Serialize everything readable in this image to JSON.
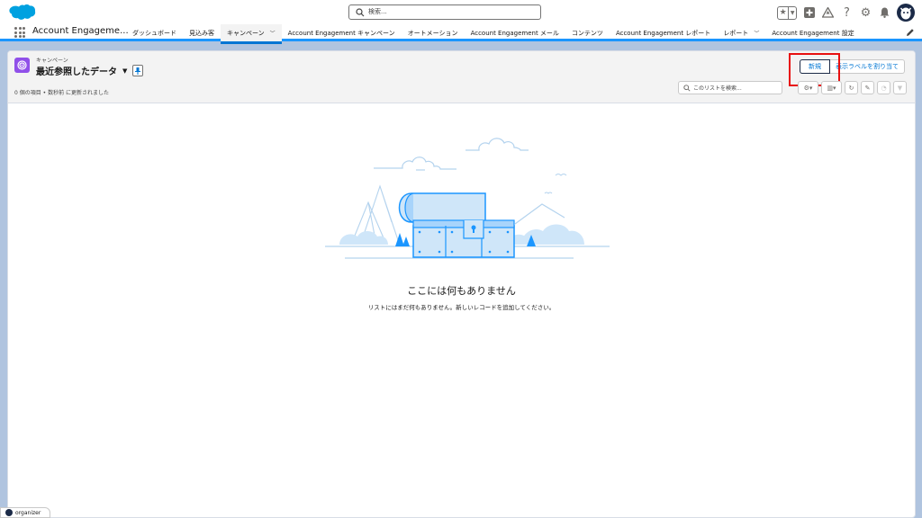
{
  "header": {
    "search_placeholder": "検索..."
  },
  "nav": {
    "app_name": "Account Engageme...",
    "items": [
      {
        "label": "ダッシュボード"
      },
      {
        "label": "見込み客"
      },
      {
        "label": "キャンペーン"
      },
      {
        "label": "Account Engagement キャンペーン"
      },
      {
        "label": "オートメーション"
      },
      {
        "label": "Account Engagement メール"
      },
      {
        "label": "コンテンツ"
      },
      {
        "label": "Account Engagement レポート"
      },
      {
        "label": "レポート"
      },
      {
        "label": "Account Engagement 設定"
      }
    ]
  },
  "list_view": {
    "object_label": "キャンペーン",
    "title": "最近参照したデータ",
    "status": "0 個の項目 • 数秒前 に更新されました",
    "new_button": "新規",
    "assign_button": "表示ラベルを割り当て",
    "search_placeholder": "このリストを検索..."
  },
  "empty_state": {
    "title": "ここには何もありません",
    "description": "リストにはまだ何もありません。新しいレコードを追加してください。"
  },
  "organizer": {
    "label": "organizer"
  },
  "colors": {
    "brand_blue": "#0176d3",
    "highlight_red": "#e81010",
    "campaign_icon": "#9050e9"
  }
}
